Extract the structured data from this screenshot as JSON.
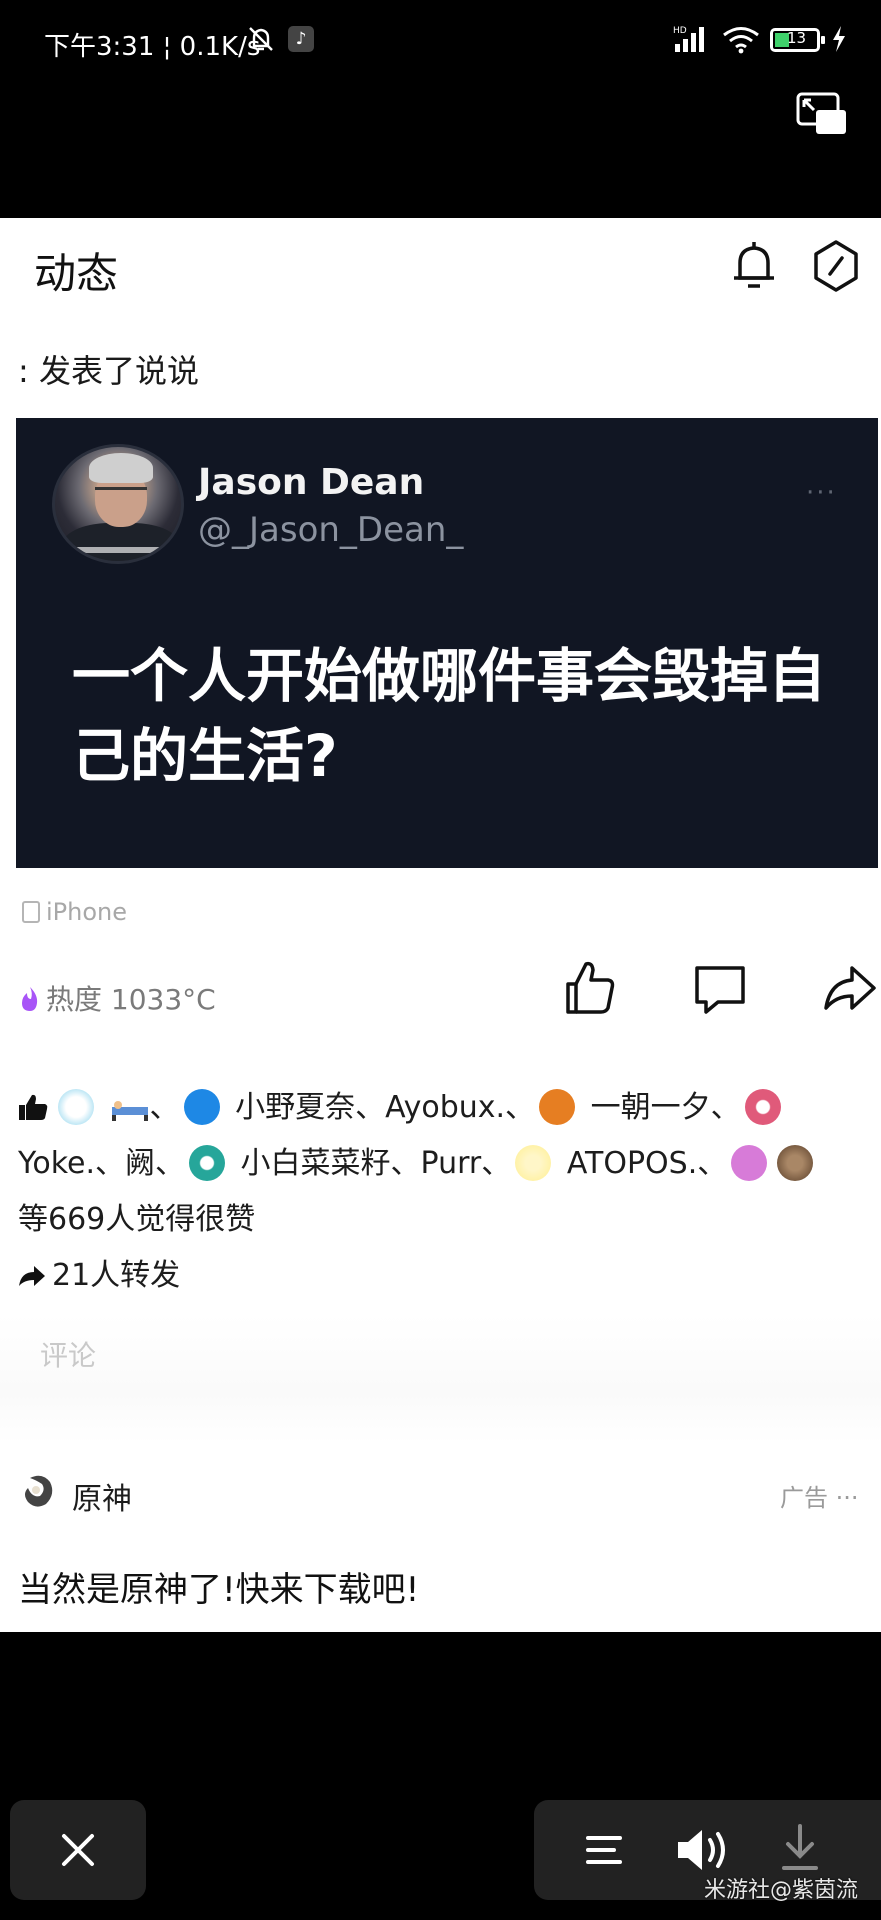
{
  "status_bar": {
    "time_speed": "下午3:31 ¦ 0.1K/s",
    "battery": "13"
  },
  "header": {
    "title": "动态"
  },
  "post": {
    "label": ": 发表了说说",
    "tweet": {
      "name": "Jason Dean",
      "handle": "@_Jason_Dean_",
      "more": "···",
      "text": "一个人开始做哪件事会毁掉自己的生活?"
    },
    "device": "iPhone",
    "heat": "热度 1033°C"
  },
  "likes": {
    "line1": [
      "小野夏奈、Ayobux.、",
      "一朝一夕、"
    ],
    "line2_a": "Yoke.、阙、",
    "line2_b": "小白菜菜籽、Purr、",
    "line2_c": "ATOPOS.、",
    "line3": "等669人觉得很赞",
    "avatar_colors": [
      "#bfe7f5",
      "#d0dcea",
      "#1e88e5",
      "#e67e22",
      "#e05a7a",
      "#26a69a",
      "#fff2a8",
      "#d77bd8",
      "#8b6b4e"
    ]
  },
  "forward": {
    "label": "21人转发"
  },
  "comment": {
    "placeholder": "评论"
  },
  "ad": {
    "name": "原神",
    "tag": "广告 ···",
    "text": "当然是原神了!快来下载吧!"
  },
  "watermark": "米游社@紫茵流"
}
